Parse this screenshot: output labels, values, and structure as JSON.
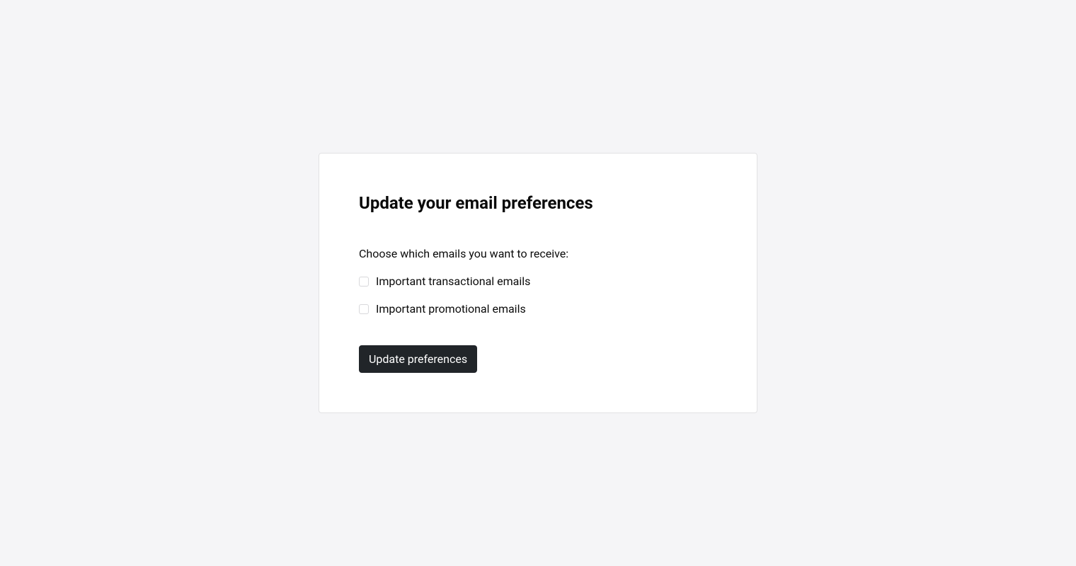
{
  "card": {
    "title": "Update your email preferences",
    "intro": "Choose which emails you want to receive:",
    "options": [
      {
        "label": "Important transactional emails"
      },
      {
        "label": "Important promotional emails"
      }
    ],
    "submit_label": "Update preferences"
  }
}
